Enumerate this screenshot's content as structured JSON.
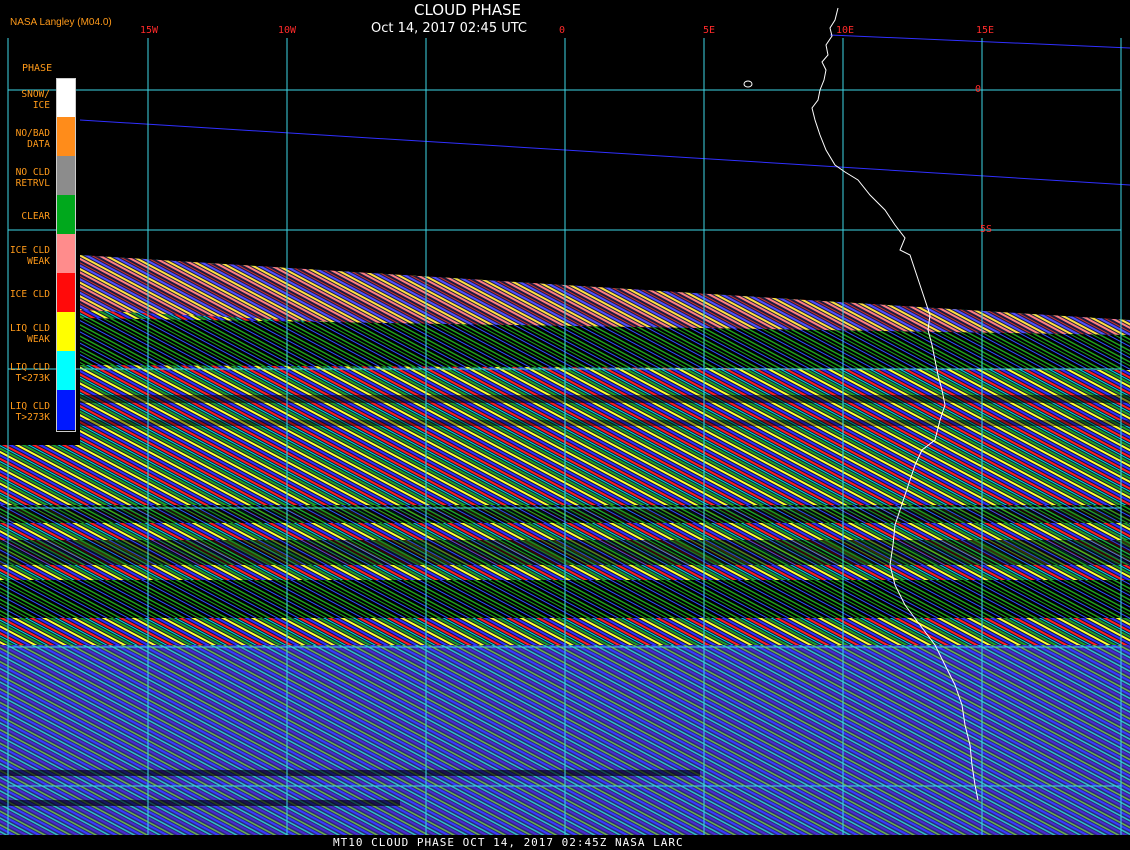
{
  "header": {
    "title": "CLOUD PHASE",
    "subtitle": "Oct 14, 2017 02:45 UTC",
    "source": "NASA Langley (M04.0)"
  },
  "footer": {
    "text": "MT10  CLOUD PHASE  OCT 14, 2017 02:45Z  NASA LARC"
  },
  "legend": {
    "title": "PHASE",
    "items": [
      {
        "label": "SNOW/\nICE",
        "color": "#ffffff"
      },
      {
        "label": "NO/BAD\nDATA",
        "color": "#ff8c1a"
      },
      {
        "label": "NO CLD\nRETRVL",
        "color": "#8c8c8c"
      },
      {
        "label": "CLEAR",
        "color": "#00a81c"
      },
      {
        "label": "ICE CLD\nWEAK",
        "color": "#ff8c8c"
      },
      {
        "label": "ICE CLD",
        "color": "#ff0a0a"
      },
      {
        "label": "LIQ CLD\nWEAK",
        "color": "#ffff00"
      },
      {
        "label": "LIQ CLD\nT<273K",
        "color": "#00ffff"
      },
      {
        "label": "LIQ CLD\nT>273K",
        "color": "#0018ff"
      }
    ]
  },
  "grid": {
    "longitudes": [
      "15W",
      "10W",
      "0",
      "5E",
      "10E",
      "15E"
    ],
    "latitudes": [
      "0",
      "5S"
    ],
    "line_color": "#3ed6e6"
  },
  "colors": {
    "coastline": "#ffffff",
    "swath_edge": "#3030ff"
  }
}
